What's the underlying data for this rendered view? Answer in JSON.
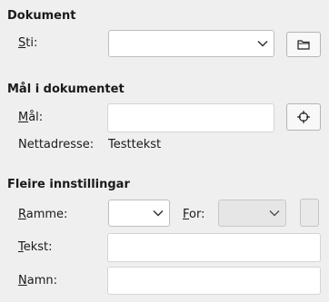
{
  "document": {
    "title": "Dokument",
    "path_label_mnemonic": "S",
    "path_label_rest": "ti:",
    "path_value": "",
    "open_icon": "folder-icon"
  },
  "target": {
    "title": "Mål i dokumentet",
    "target_label_mnemonic": "M",
    "target_label_rest": "ål:",
    "target_value": "",
    "target_icon": "crosshair-icon",
    "url_label": "Nettadresse:",
    "url_value": "Testtekst"
  },
  "more": {
    "title": "Fleire innstillingar",
    "frame_label_mnemonic": "R",
    "frame_label_rest": "amme:",
    "frame_value": "",
    "form_label_mnemonic": "F",
    "form_label_rest": "or:",
    "form_value": "",
    "text_label_mnemonic": "T",
    "text_label_rest": "ekst:",
    "text_value": "",
    "name_label_mnemonic": "N",
    "name_label_rest": "amn:",
    "name_value": ""
  }
}
